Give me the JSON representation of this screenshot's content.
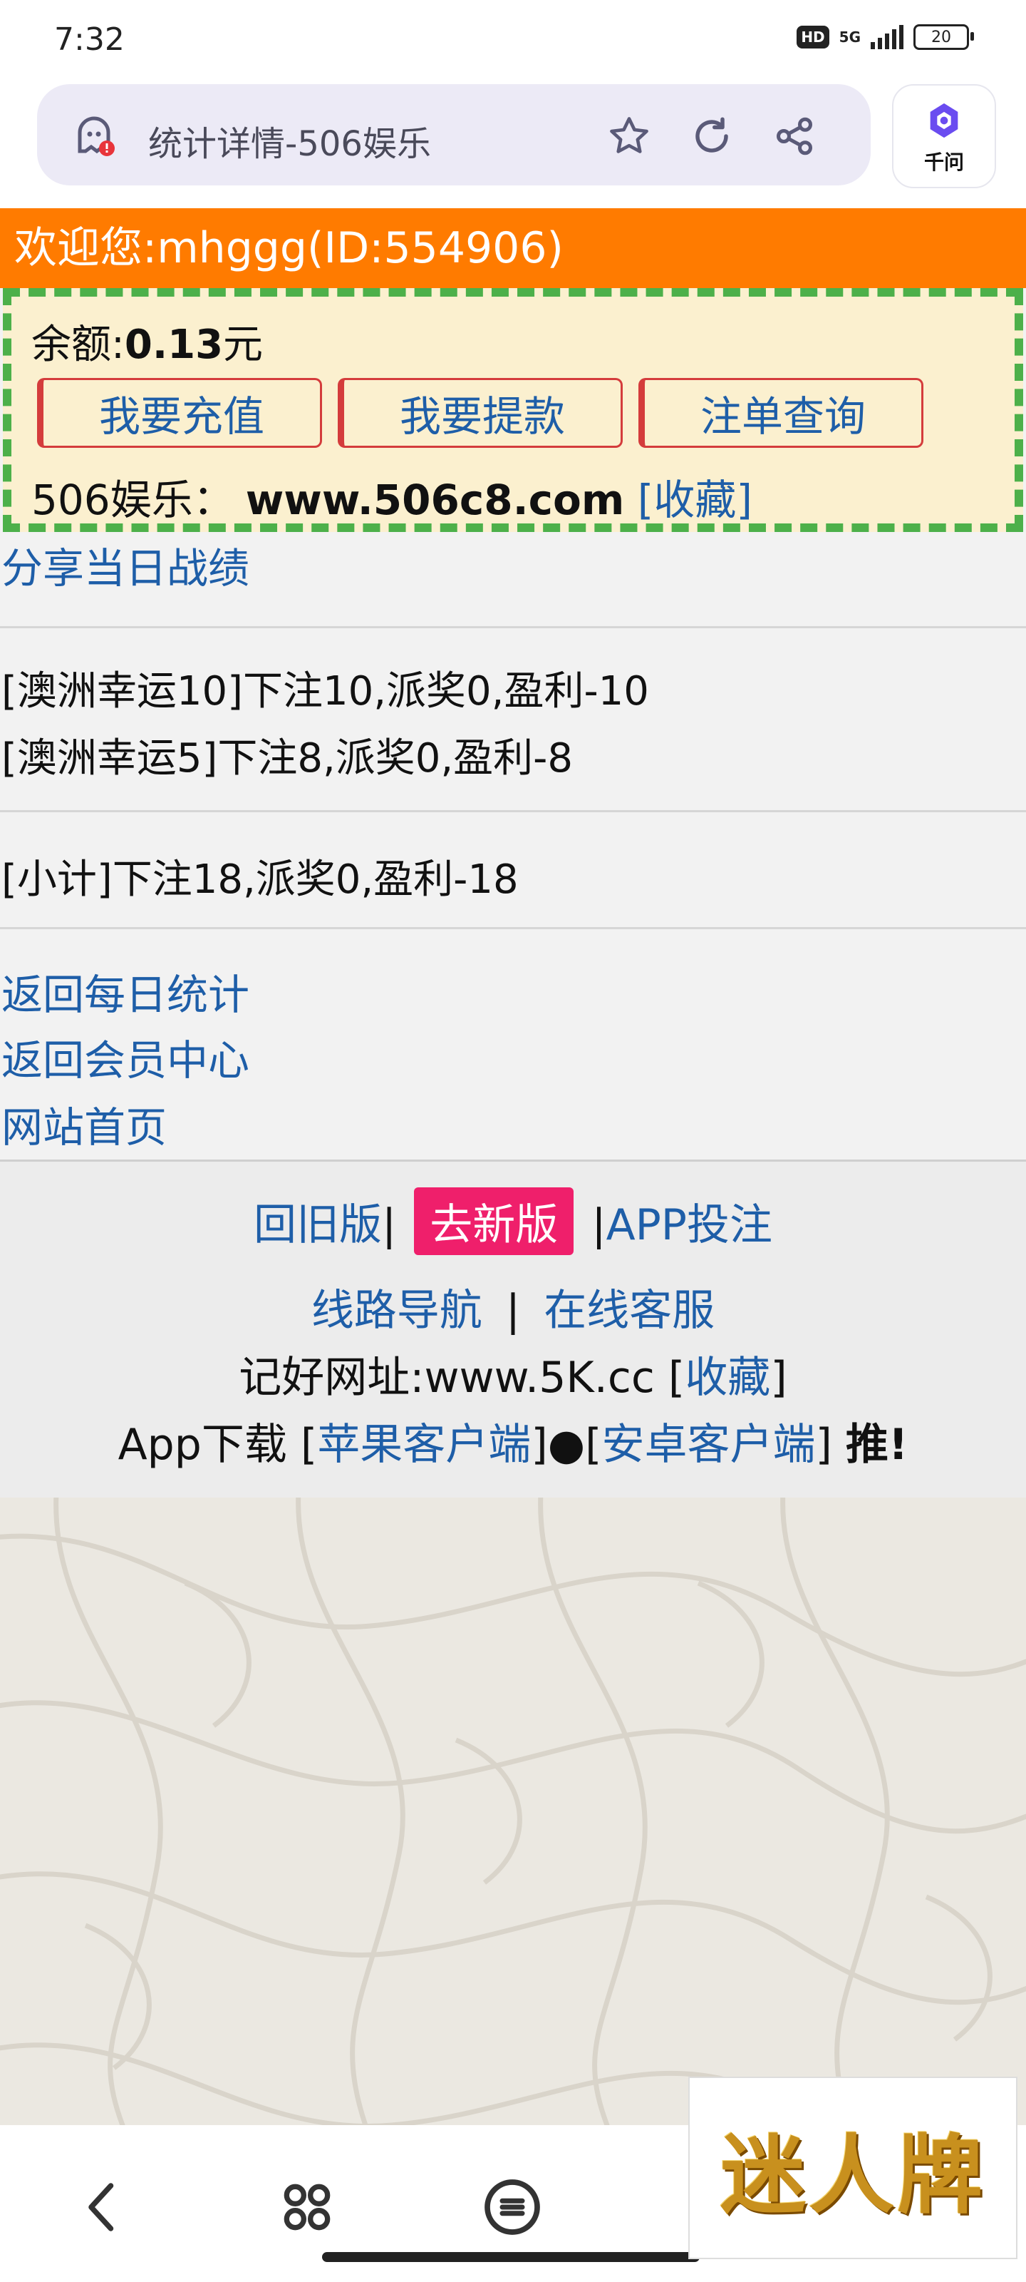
{
  "status_bar": {
    "time": "7:32",
    "hd": "HD",
    "network": "5G",
    "battery": "20"
  },
  "browser": {
    "tab_title": "统计详情-506娱乐",
    "assistant_label": "千问",
    "icons": [
      "ghost-shield-icon",
      "star-icon",
      "refresh-icon",
      "share-icon",
      "qianwen-icon"
    ]
  },
  "welcome": "欢迎您:mhggg(ID:554906)",
  "account": {
    "balance_label": "余额:",
    "balance_value": "0.13",
    "balance_unit": "元",
    "buttons": [
      "我要充值",
      "我要提款",
      "注单查询"
    ],
    "site_label": "506娱乐：",
    "site_url": "www.506c8.com",
    "bookmark": "[收藏]"
  },
  "share_link": "分享当日战绩",
  "records": [
    "[澳洲幸运10]下注10,派奖0,盈利-10",
    "[澳洲幸运5]下注8,派奖0,盈利-8"
  ],
  "subtotal": "[小计]下注18,派奖0,盈利-18",
  "nav_links": [
    "返回每日统计",
    "返回会员中心",
    "网站首页"
  ],
  "footer": {
    "old_version": "回旧版",
    "sep1": "|",
    "new_version": "去新版",
    "sep2": "|",
    "app_bet": "APP投注",
    "route_nav": "线路导航",
    "sep3": "|",
    "online_service": "在线客服",
    "remember_label": "记好网址:www.5K.cc",
    "remember_bookmark": "收藏",
    "app_download": "App下载",
    "ios_client": "苹果客户端",
    "dot": "●",
    "android_client": "安卓客户端",
    "recommend": "推!"
  },
  "ad_text": "迷人牌",
  "colors": {
    "welcome_bg": "#ff7b00",
    "account_bg": "#fbf0cf",
    "dash_border": "#4db04a",
    "button_border": "#d43c3c",
    "link": "#1e5ea8",
    "new_version_bg": "#ef1f6b"
  }
}
